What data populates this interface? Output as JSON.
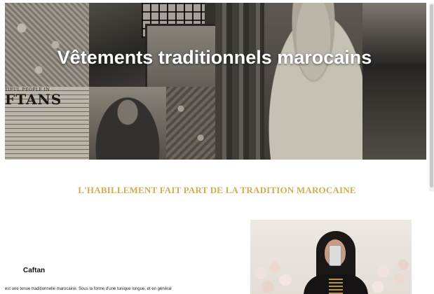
{
  "hero": {
    "title": "Vêtements traditionnels marocains",
    "collage_text_small": "TIFUL PEOPLE IN",
    "collage_text_big": "FTANS"
  },
  "section": {
    "heading": "L'HABILLEMENT FAIT PART DE LA TRADITION MAROCAINE"
  },
  "caftan": {
    "title": "Caftan",
    "text": "est une tenue traditionnelle marocaine. Sous la forme d'une tunique longue, et en général"
  },
  "colors": {
    "heading_gold": "#d1ac52",
    "hero_text": "#ffffff"
  }
}
